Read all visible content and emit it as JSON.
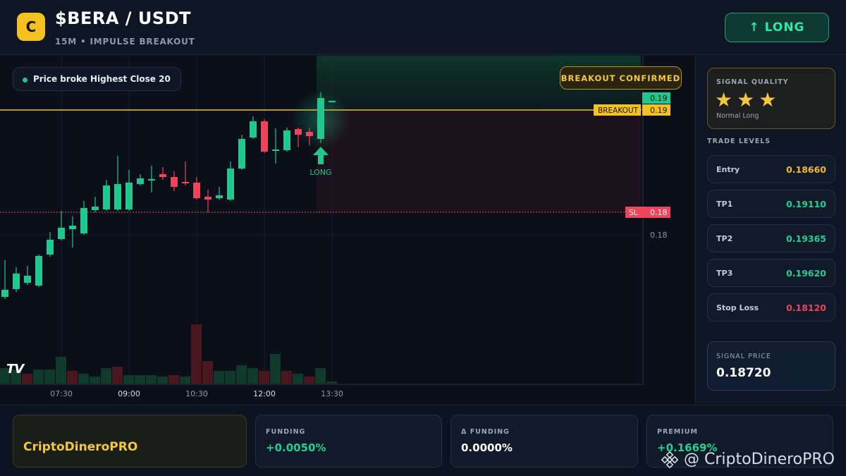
{
  "header": {
    "logo_letter": "C",
    "title": "$BERA / USDT",
    "subtitle": "15M • IMPULSE BREAKOUT",
    "direction_button": "↑ LONG"
  },
  "chart": {
    "info_pill": "Price broke Highest Close 20",
    "confirm_badge": "BREAKOUT CONFIRMED",
    "long_marker": "LONG",
    "breakout_tag": "BREAKOUT",
    "breakout_value": "0.19",
    "current_value": "0.19",
    "sl_tag": "SL",
    "sl_value": "0.18",
    "axis_price": "0.18",
    "time_labels": [
      "07:30",
      "09:00",
      "10:30",
      "12:00",
      "13:30"
    ],
    "tv_logo": "TV",
    "colors": {
      "up": "#22c78b",
      "down": "#f0445a",
      "breakout": "#f3c220"
    }
  },
  "panel": {
    "signal_quality_title": "SIGNAL QUALITY",
    "stars": 3,
    "signal_quality_note": "Normal Long",
    "trade_levels_title": "TRADE LEVELS",
    "levels": [
      {
        "name": "Entry",
        "value": "0.18660",
        "color": "#f3b92b"
      },
      {
        "name": "TP1",
        "value": "0.19110",
        "color": "#22d08f"
      },
      {
        "name": "TP2",
        "value": "0.19365",
        "color": "#22d08f"
      },
      {
        "name": "TP3",
        "value": "0.19620",
        "color": "#22d08f"
      },
      {
        "name": "Stop Loss",
        "value": "0.18120",
        "color": "#f0445a"
      }
    ],
    "signal_price_title": "SIGNAL PRICE",
    "signal_price": "0.18720"
  },
  "footer": {
    "brand": "CriptoDineroPRO",
    "metrics": [
      {
        "label": "FUNDING",
        "value": "+0.0050%",
        "color": "#22d08f"
      },
      {
        "label": "Δ FUNDING",
        "value": "0.0000%",
        "color": "#ffffff"
      },
      {
        "label": "PREMIUM",
        "value": "+0.1669%",
        "color": "#22d08f"
      }
    ],
    "watermark": "@ CriptoDineroPRO"
  }
}
